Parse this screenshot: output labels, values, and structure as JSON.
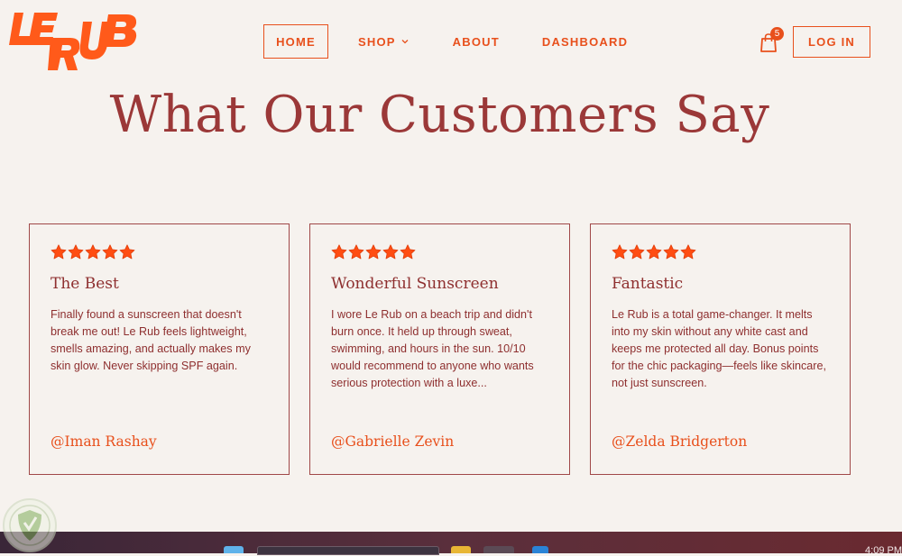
{
  "brand": {
    "logo_text": "LE RUB"
  },
  "nav": {
    "items": [
      {
        "label": "HOME"
      },
      {
        "label": "SHOP"
      },
      {
        "label": "ABOUT"
      },
      {
        "label": "DASHBOARD"
      }
    ],
    "cart_count": "5",
    "login_label": "LOG IN"
  },
  "heading": "What Our Customers Say",
  "reviews": [
    {
      "rating": 5,
      "title": "The Best",
      "body": "Finally found a sunscreen that doesn't break me out! Le Rub feels lightweight, smells amazing, and actually makes my skin glow. Never skipping SPF again.",
      "author": "@Iman Rashay"
    },
    {
      "rating": 5,
      "title": "Wonderful Sunscreen",
      "body": "I wore Le Rub on a beach trip and didn't burn once. It held up through sweat, swimming, and hours in the sun. 10/10 would recommend to anyone who wants serious protection with a luxe...",
      "author": "@Gabrielle Zevin"
    },
    {
      "rating": 5,
      "title": "Fantastic",
      "body": "Le Rub is a total game-changer. It melts into my skin without any white cast and keeps me protected all day. Bonus points for the chic packaging—feels like skincare, not just sunscreen.",
      "author": "@Zelda Bridgerton"
    }
  ],
  "taskbar": {
    "clock": "4:09 PM"
  },
  "colors": {
    "accent": "#e8501c",
    "maroon": "#9b3838",
    "background": "#f6f2ee"
  }
}
